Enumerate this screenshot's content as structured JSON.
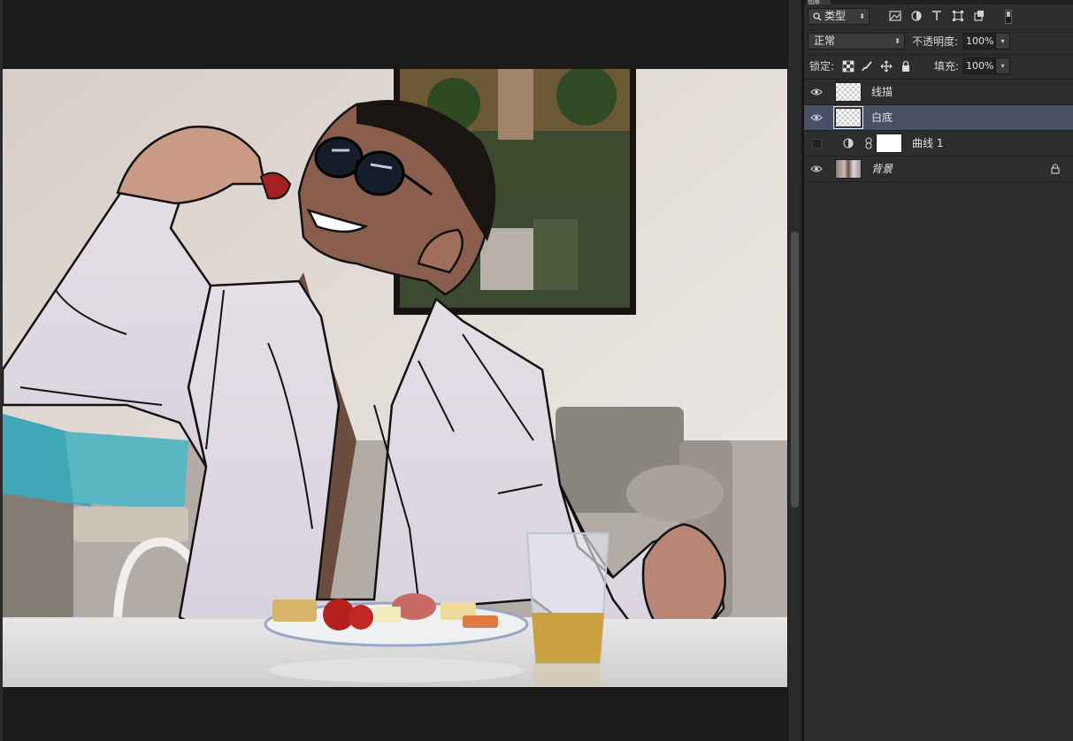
{
  "layers_panel": {
    "tab_label": "图层",
    "filter_kind": "类型",
    "filter_icons": [
      "image-filter-icon",
      "adjustment-filter-icon",
      "type-filter-icon",
      "shape-filter-icon",
      "smart-object-filter-icon",
      "filter-toggle-icon"
    ],
    "blend_mode": "正常",
    "opacity_label": "不透明度:",
    "opacity_value": "100%",
    "lock_label": "锁定:",
    "fill_label": "填充:",
    "fill_value": "100%",
    "layers": [
      {
        "name": "线描",
        "visible": true,
        "selected": false,
        "type": "pixel"
      },
      {
        "name": "白底",
        "visible": true,
        "selected": true,
        "type": "pixel"
      },
      {
        "name": "曲线 1",
        "visible": false,
        "selected": false,
        "type": "adjustment"
      },
      {
        "name": "背景",
        "visible": true,
        "selected": false,
        "type": "background",
        "locked": true
      }
    ]
  },
  "colors": {
    "selected_layer": "#485064",
    "panel_bg": "#2d2d2d",
    "canvas_bg": "#1b1b1b"
  }
}
